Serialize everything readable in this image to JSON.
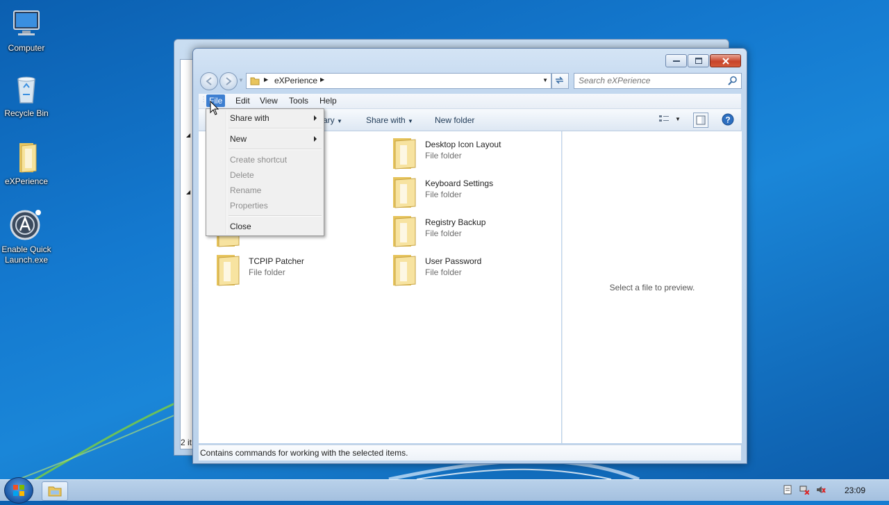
{
  "desktop": {
    "icons": [
      {
        "label": "Computer",
        "icon": "computer-icon"
      },
      {
        "label": "Recycle Bin",
        "icon": "recycle-bin-icon"
      },
      {
        "label": "eXPerience",
        "icon": "folder-icon"
      },
      {
        "label": "Enable Quick Launch.exe",
        "icon": "app-icon"
      }
    ]
  },
  "back_window": {
    "status_partial": "2 it"
  },
  "window": {
    "address": {
      "path": "eXPerience"
    },
    "search": {
      "placeholder": "Search eXPerience"
    },
    "menubar": [
      "File",
      "Edit",
      "View",
      "Tools",
      "Help"
    ],
    "toolbar": {
      "include_partial": "ary",
      "share_with": "Share with",
      "new_folder": "New folder"
    },
    "items": [
      {
        "name": "Desktop Icon Layout",
        "type": "File folder"
      },
      {
        "name": "Keyboard Settings",
        "type": "File folder"
      },
      {
        "name": "Registry Backup",
        "type": "File folder"
      },
      {
        "name": "TCPIP Patcher",
        "type": "File folder"
      },
      {
        "name": "User Password",
        "type": "File folder"
      },
      {
        "name": "",
        "type": "File folder"
      }
    ],
    "preview_text": "Select a file to preview.",
    "status_text": "Contains commands for working with the selected items."
  },
  "file_menu": {
    "share_with": "Share with",
    "new": "New",
    "create_shortcut": "Create shortcut",
    "delete": "Delete",
    "rename": "Rename",
    "properties": "Properties",
    "close": "Close"
  },
  "taskbar": {
    "clock": "23:09"
  },
  "colors": {
    "menu_highlight": "#3d7fd1",
    "close_button": "#c7442a"
  }
}
